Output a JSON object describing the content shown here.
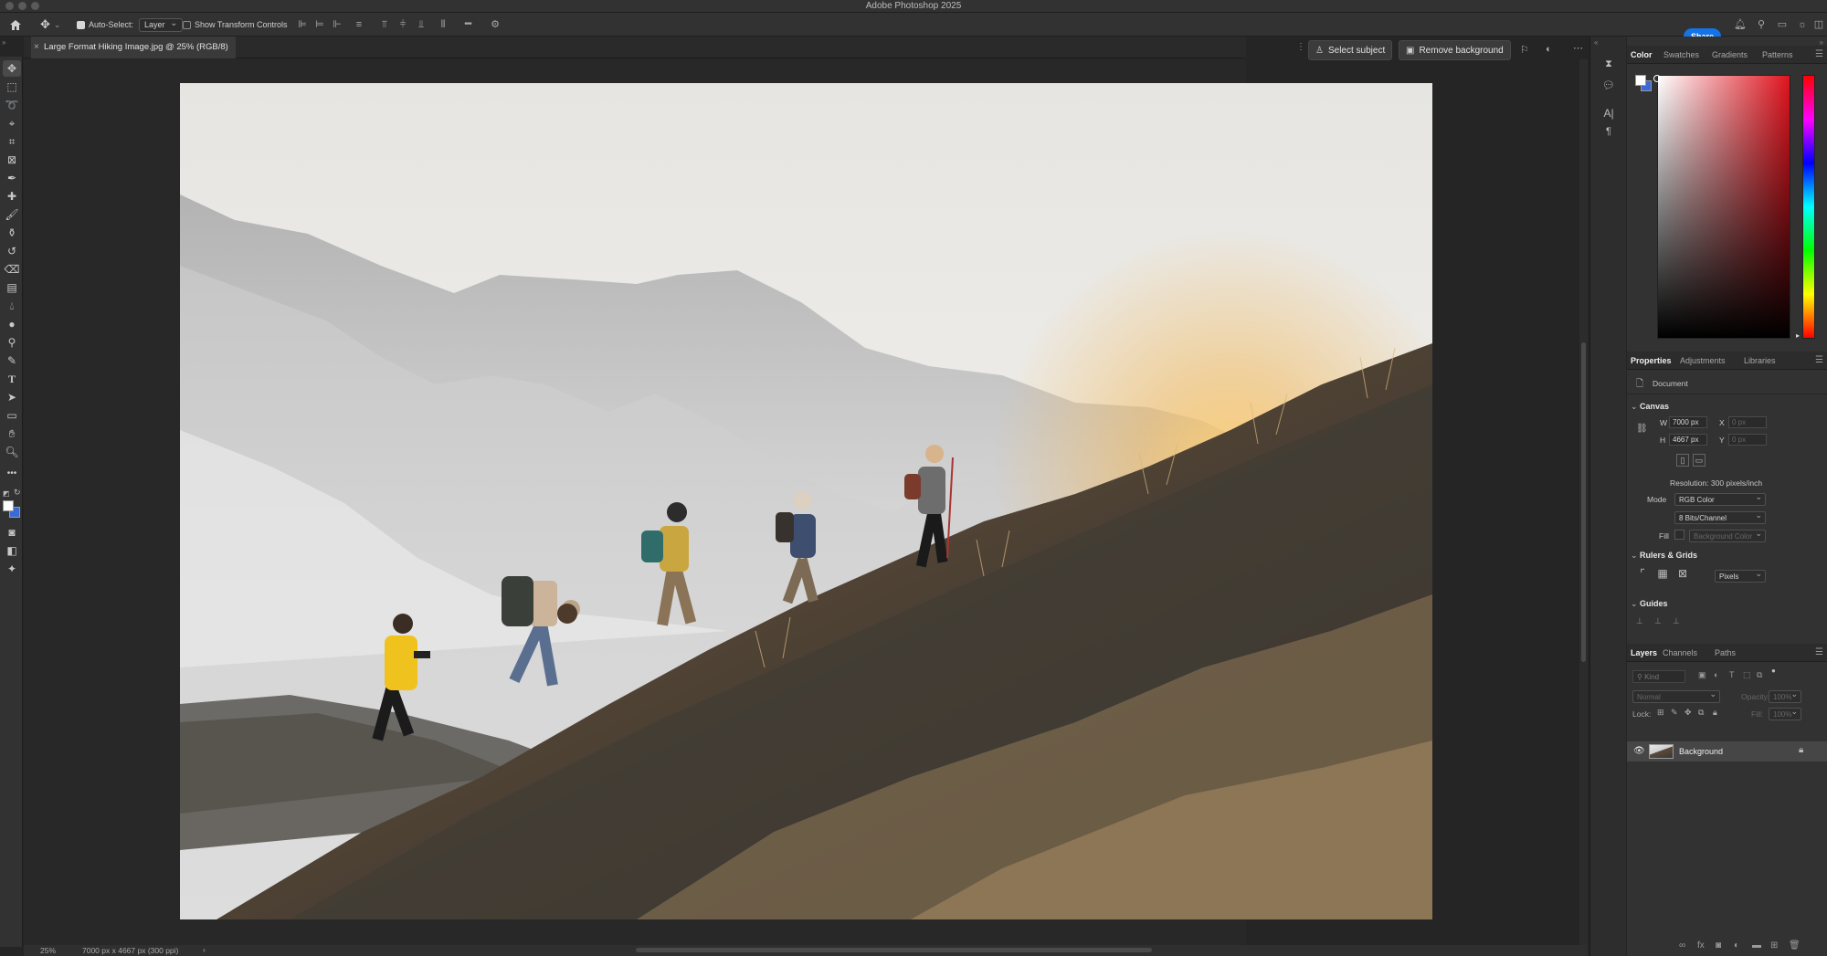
{
  "app": {
    "title": "Adobe Photoshop 2025",
    "share_label": "Share"
  },
  "options_bar": {
    "auto_select_label": "Auto-Select:",
    "auto_select_checked": true,
    "auto_select_target": "Layer",
    "show_transform_label": "Show Transform Controls",
    "show_transform_checked": false,
    "more_label": "•••"
  },
  "document": {
    "tab_title": "Large Format Hiking Image.jpg @ 25% (RGB/8)",
    "zoom": "25%",
    "info": "7000 px x 4667 px (300 ppi)"
  },
  "contextual_taskbar": {
    "select_subject_label": "Select subject",
    "remove_background_label": "Remove background"
  },
  "color_panel": {
    "tabs": [
      "Color",
      "Swatches",
      "Gradients",
      "Patterns"
    ],
    "active_tab": "Color",
    "hue_base": "#e0141e"
  },
  "properties_panel": {
    "tabs": [
      "Properties",
      "Adjustments",
      "Libraries"
    ],
    "active_tab": "Properties",
    "type_label": "Document",
    "canvas_section": "Canvas",
    "w_label": "W",
    "w_value": "7000 px",
    "h_label": "H",
    "h_value": "4667 px",
    "x_label": "X",
    "y_label": "Y",
    "x_placeholder": "0 px",
    "y_placeholder": "0 px",
    "resolution": "Resolution: 300 pixels/inch",
    "mode_label": "Mode",
    "mode_value": "RGB Color",
    "bits_value": "8 Bits/Channel",
    "fill_label": "Fill",
    "fill_value": "Background Color",
    "rulers_section": "Rulers & Grids",
    "units_value": "Pixels",
    "guides_section": "Guides"
  },
  "layers_panel": {
    "tabs": [
      "Layers",
      "Channels",
      "Paths"
    ],
    "active_tab": "Layers",
    "kind_placeholder": "Kind",
    "blend_mode": "Normal",
    "opacity_label": "Opacity:",
    "opacity_value": "100%",
    "lock_label": "Lock:",
    "fill_label": "Fill:",
    "fill_value": "100%",
    "layers": [
      {
        "name": "Background",
        "visible": true,
        "locked": true
      }
    ]
  },
  "image_scene": {
    "sky_color": "#f2f1ed",
    "mountain_color": "#c9c9c9",
    "slope_color": "#4c4034",
    "sun_color": "#f7b851"
  }
}
